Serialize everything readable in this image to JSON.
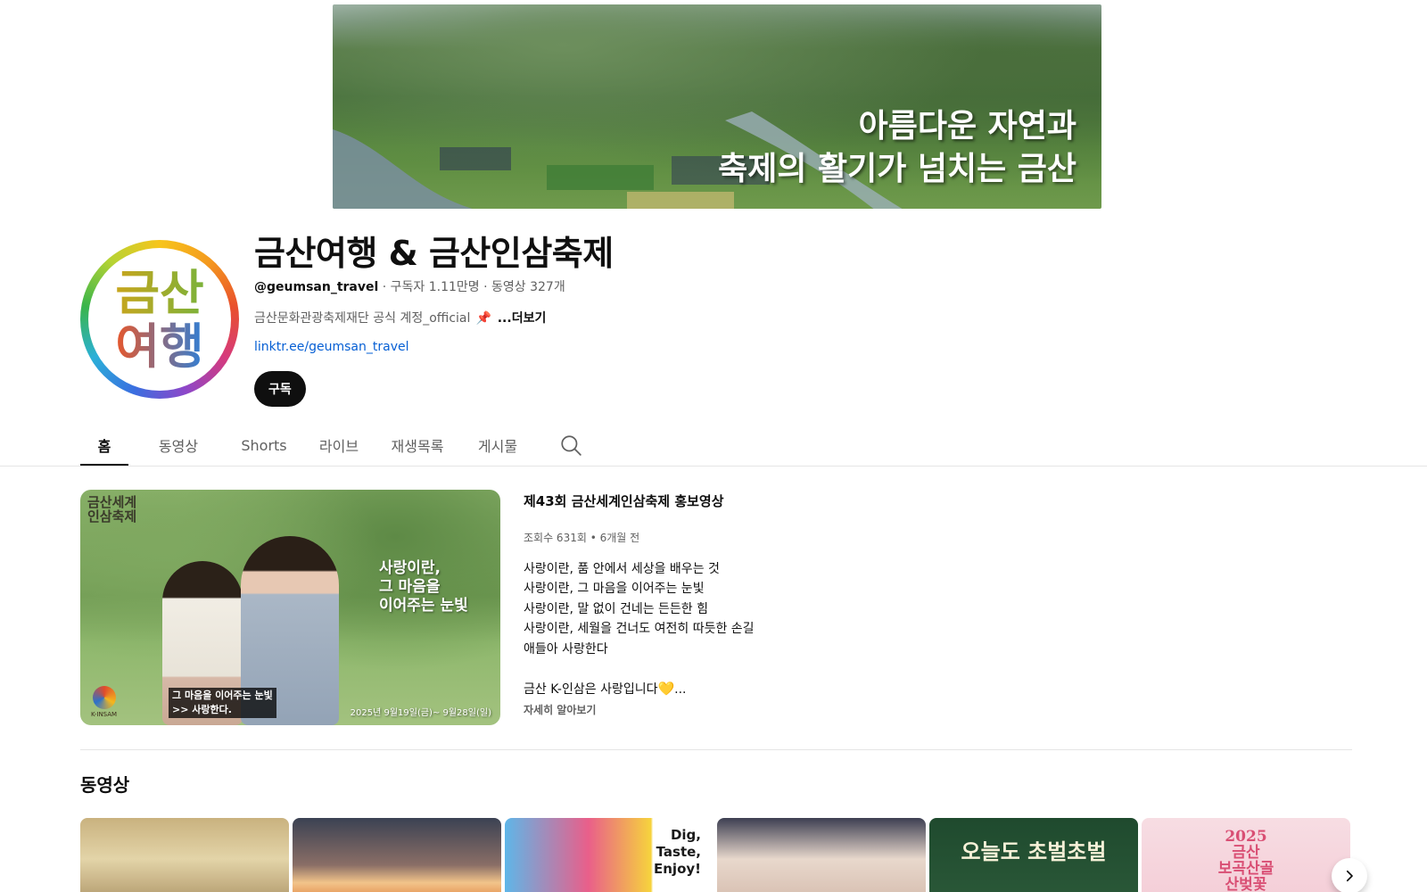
{
  "banner": {
    "line1": "아름다운 자연과",
    "line2": "축제의 활기가 넘치는 금산"
  },
  "avatar": {
    "line1": "금산",
    "line2": "여행"
  },
  "channel": {
    "title": "금산여행 & 금산인삼축제",
    "handle": "@geumsan_travel",
    "subscribers": " · 구독자 1.11만명 · 동영상 327개",
    "description": "금산문화관광축제재단 공식 계정_official",
    "more_label": "...더보기",
    "link": "linktr.ee/geumsan_travel",
    "subscribe_label": "구독"
  },
  "tabs": [
    {
      "label": "홈",
      "active": true
    },
    {
      "label": "동영상"
    },
    {
      "label": "Shorts"
    },
    {
      "label": "라이브"
    },
    {
      "label": "재생목록"
    },
    {
      "label": "게시물"
    }
  ],
  "featured": {
    "thumb_logo": "금산세계\n인삼축제",
    "thumb_overlay": "사랑이란,\n그 마음을\n이어주는 눈빛",
    "thumb_caption_line1": "그 마음을 이어주는 눈빛",
    "thumb_caption_line2": ">> 사랑한다.",
    "thumb_date": "2025년 9월19일(금)~ 9월28일(일)",
    "thumb_brand": "K-INSAM",
    "title": "제43회 금산세계인삼축제 홍보영상",
    "stats": "조회수 631회 • 6개월 전",
    "description": "사랑이란, 품 안에서 세상을 배우는 것\n사랑이란, 그 마음을 이어주는 눈빛\n사랑이란, 말 없이 건네는 든든한 힘\n사랑이란, 세월을 건너도 여전히 따듯한 손길\n애들아 사랑한다\n\n금산 K-인삼은 사랑입니다",
    "description_tail": "...",
    "more_label": "자세히 알아보기"
  },
  "videos_section": {
    "title": "동영상",
    "thumbs": [
      {
        "text": ""
      },
      {
        "text": ""
      },
      {
        "text": "Dig,\nTaste,\nEnjoy!"
      },
      {
        "text": ""
      },
      {
        "text": "오늘도 초벌초벌"
      },
      {
        "text": "2025\n금산\n보곡산골\n산벚꽃"
      }
    ]
  },
  "colors": {
    "text_primary": "#0f0f0f",
    "text_secondary": "#606060",
    "link": "#065fd4",
    "button_bg": "#0f0f0f"
  },
  "icons": {
    "search": "search-icon",
    "pin": "pin-icon",
    "heart": "heart-icon",
    "next": "chevron-right-icon"
  }
}
